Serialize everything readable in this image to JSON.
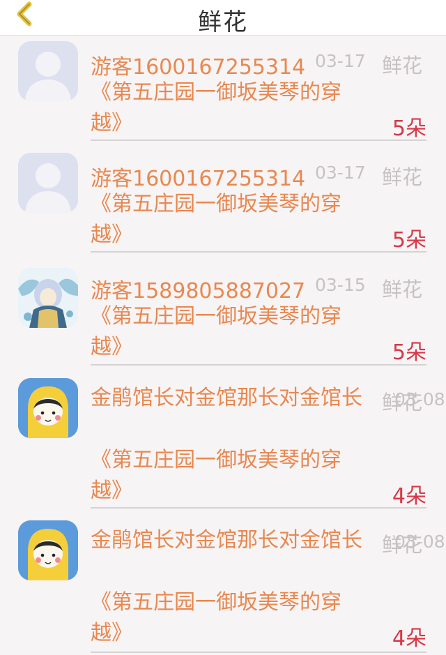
{
  "header": {
    "title": "鲜花"
  },
  "items": [
    {
      "name": "游客1600167255314",
      "date": "03-17",
      "type": "鲜花",
      "book": "《第五庄园一御坂美琴的穿越》",
      "count": "5朵"
    },
    {
      "name": "游客1600167255314",
      "date": "03-17",
      "type": "鲜花",
      "book": "《第五庄园一御坂美琴的穿越》",
      "count": "5朵"
    },
    {
      "name": "游客1589805887027",
      "date": "03-15",
      "type": "鲜花",
      "book": "《第五庄园一御坂美琴的穿越》",
      "count": "5朵"
    },
    {
      "name": "金鹃馆长对金馆那长对金馆长",
      "date": "03-08",
      "type": "鲜花",
      "book": "《第五庄园一御坂美琴的穿越》",
      "count": "4朵"
    },
    {
      "name": "金鹃馆长对金馆那长对金馆长",
      "date": "03-08",
      "type": "鲜花",
      "book": "《第五庄园一御坂美琴的穿越》",
      "count": "4朵"
    }
  ]
}
